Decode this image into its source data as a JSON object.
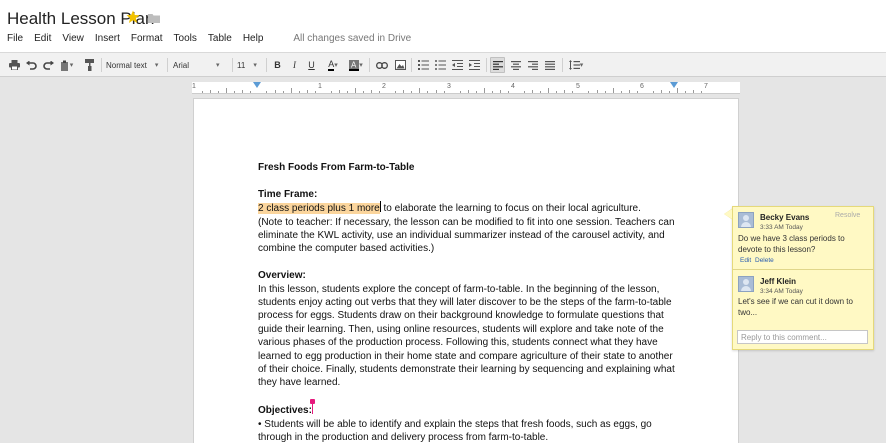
{
  "document": {
    "title": "Health Lesson Plan",
    "save_status": "All changes saved in Drive"
  },
  "menu": [
    "File",
    "Edit",
    "View",
    "Insert",
    "Format",
    "Tools",
    "Table",
    "Help"
  ],
  "toolbar": {
    "style": "Normal text",
    "font": "Arial",
    "size": "11",
    "bold_label": "B",
    "italic_label": "I",
    "underline_label": "U",
    "text_color_label": "A"
  },
  "ruler": {
    "numbers": [
      "1",
      "1",
      "2",
      "3",
      "4",
      "5",
      "6",
      "7"
    ]
  },
  "content": {
    "heading": "Fresh Foods From Farm-to-Table",
    "timeframe_heading": "Time Frame:",
    "timeframe_highlight": "2 class periods plus 1 more",
    "timeframe_rest": " to elaborate the learning to focus on their local agriculture.",
    "timeframe_note_1": "(Note to teacher: If necessary, the lesson can be modified to fit into one session. Teachers can",
    "timeframe_note_2": "eliminate the KWL activity, use an individual summarizer instead of the carousel activity, and",
    "timeframe_note_3": "combine the computer based activities.)",
    "overview_heading": "Overview:",
    "overview_lines": [
      "In this lesson, students explore the concept of farm-to-table. In the beginning of the lesson,",
      "students enjoy acting out verbs that they will later discover to be the steps of the farm-to-table",
      "process for eggs. Students draw on their background knowledge to formulate questions that",
      "guide their learning. Then, using online resources, students will explore and take note of the",
      "various phases of the production process. Following this, students connect what they have",
      "learned to egg production in their home state and compare agriculture of their state to another",
      "of their choice. Finally, students demonstrate their learning by sequencing and explaining what",
      "they have learned."
    ],
    "objectives_heading": "Objectives:",
    "objectives_lines": [
      "• Students will be able to identify and explain the steps that fresh foods, such as eggs, go",
      "through in the production and delivery process from farm-to-table."
    ]
  },
  "comments": [
    {
      "author": "Becky Evans",
      "time": "3:33 AM Today",
      "text": "Do we have 3 class periods to devote to this lesson?",
      "resolve": "Resolve",
      "edit": "Edit",
      "delete": "Delete"
    },
    {
      "author": "Jeff Klein",
      "time": "3:34 AM Today",
      "text": "Let's see if we can cut it down to two..."
    }
  ],
  "reply_placeholder": "Reply to this comment...",
  "colors": {
    "highlight": "#fbd59c",
    "comment_bg": "#fff9c4",
    "star": "#f2c200",
    "link": "#2a5db0",
    "collaborator_caret": "#e6197d"
  },
  "icons": [
    "star-icon",
    "folder-icon",
    "print-icon",
    "undo-icon",
    "redo-icon",
    "paint-format-icon",
    "link-icon",
    "image-icon",
    "numbered-list-icon",
    "bulleted-list-icon",
    "decrease-indent-icon",
    "increase-indent-icon",
    "align-left-icon",
    "align-center-icon",
    "align-right-icon",
    "justify-icon",
    "line-spacing-icon",
    "avatar"
  ]
}
